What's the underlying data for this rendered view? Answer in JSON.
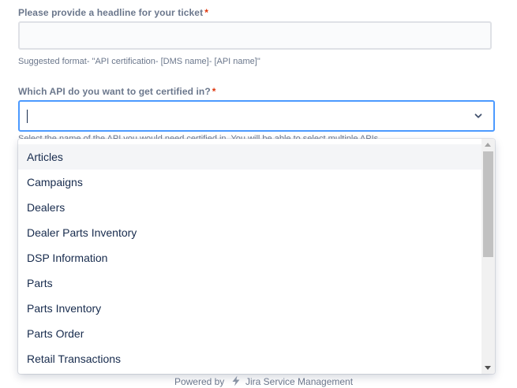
{
  "headline_field": {
    "label": "Please provide a headline for your ticket",
    "required_marker": "*",
    "value": "",
    "help": "Suggested format- \"API certification- [DMS name]- [API name]\""
  },
  "api_field": {
    "label": "Which API do you want to get certified in?",
    "required_marker": "*",
    "value": "",
    "help": "Select the name of the API you would need certified in. You will be able to select multiple APIs."
  },
  "dropdown": {
    "options": [
      "Articles",
      "Campaigns",
      "Dealers",
      "Dealer Parts Inventory",
      "DSP Information",
      "Parts",
      "Parts Inventory",
      "Parts Order",
      "Retail Transactions"
    ],
    "highlighted_index": 0
  },
  "footer": {
    "powered_by": "Powered by",
    "product": "Jira Service Management"
  },
  "colors": {
    "label": "#6b778c",
    "required": "#de350b",
    "focus_border": "#4c9aff",
    "option_hover": "#f4f5f7",
    "text": "#172b4d"
  },
  "icons": {
    "select_toggle": "chevron-down-icon",
    "footer_logo": "jira-lightning-icon"
  }
}
